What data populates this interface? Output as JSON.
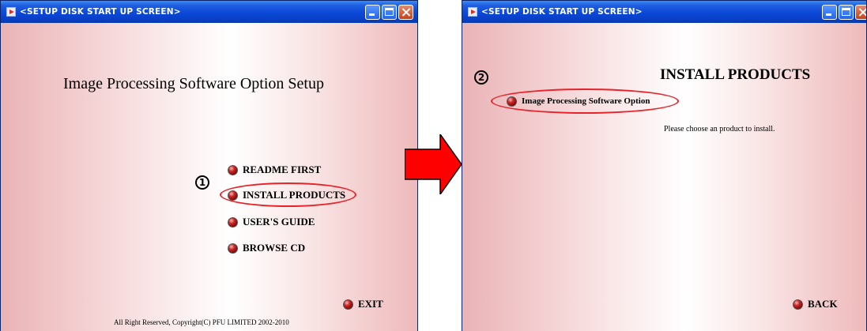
{
  "left_window": {
    "title": "<SETUP DISK START UP SCREEN>",
    "heading": "Image Processing Software Option Setup",
    "step_number": "1",
    "menu": [
      {
        "label": "README FIRST"
      },
      {
        "label": "INSTALL PRODUCTS"
      },
      {
        "label": "USER'S GUIDE"
      },
      {
        "label": "BROWSE CD"
      }
    ],
    "exit_label": "EXIT",
    "copyright": "All Right Reserved, Copyright(C) PFU LIMITED 2002-2010"
  },
  "right_window": {
    "title": "<SETUP DISK START UP SCREEN>",
    "heading": "INSTALL PRODUCTS",
    "step_number": "2",
    "product_label": "Image Processing Software Option",
    "instruction": "Please choose an product to install.",
    "back_label": "BACK"
  },
  "colors": {
    "titlebar": "#0b48d8",
    "highlight": "#e8232a",
    "arrow": "#ff0000"
  },
  "arrow_icon": "red-right-arrow"
}
